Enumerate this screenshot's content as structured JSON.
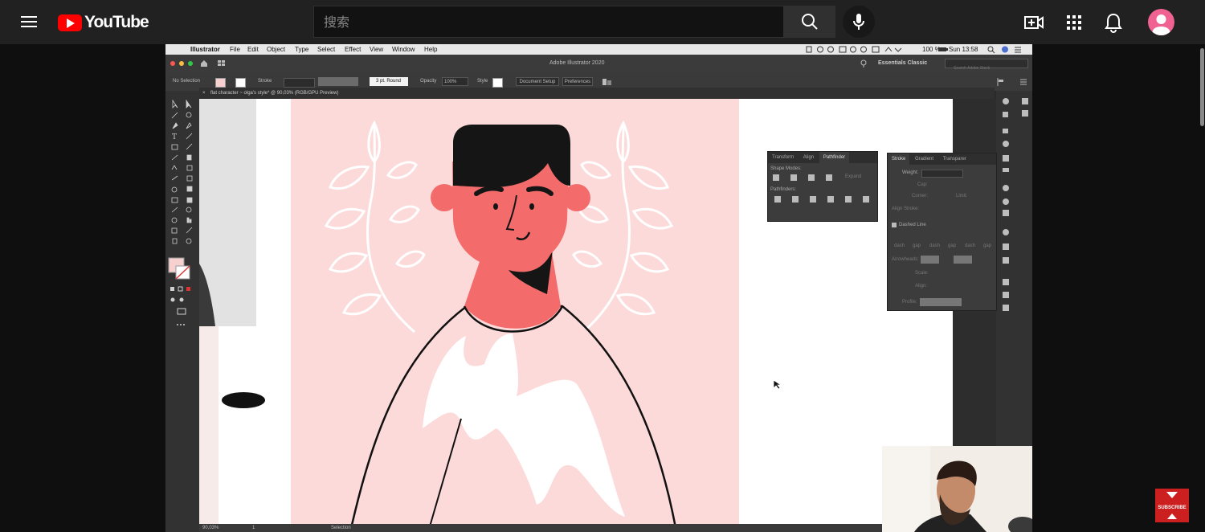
{
  "youtube": {
    "logo_text": "YouTube",
    "search_placeholder": "搜索",
    "icons": [
      "menu-icon",
      "search-icon",
      "mic-icon",
      "create-video-icon",
      "apps-grid-icon",
      "notifications-bell-icon",
      "account-avatar-icon"
    ],
    "colors": {
      "header_bg": "#212121",
      "page_bg": "#0f0f0f",
      "brand_red": "#ff0000",
      "avatar_pink": "#f06292"
    }
  },
  "mac_menubar": {
    "app": "Illustrator",
    "menus": [
      "File",
      "Edit",
      "Object",
      "Type",
      "Select",
      "Effect",
      "View",
      "Window",
      "Help"
    ],
    "battery": "100 %",
    "clock": "Sun 13:58"
  },
  "illustrator": {
    "window_title": "Adobe Illustrator 2020",
    "workspace": "Essentials Classic",
    "stock_search_placeholder": "Search Adobe Stock",
    "control_bar": {
      "selection": "No Selection",
      "stroke_label": "Stroke",
      "brush": "3 pt. Round",
      "opacity_label": "Opacity",
      "opacity_value": "100%",
      "style_label": "Style",
      "document_setup": "Document Setup",
      "preferences": "Preferences"
    },
    "doc_tab": "flat character ~ olga's style* @ 90,03% (RGB/GPU Preview)",
    "pathfinder_panel": {
      "tabs": [
        "Transform",
        "Align",
        "Pathfinder"
      ],
      "shape_modes_label": "Shape Modes:",
      "expand_label": "Expand",
      "pathfinders_label": "Pathfinders:"
    },
    "stroke_panel": {
      "tabs": [
        "Stroke",
        "Gradient",
        "Transparer"
      ],
      "weight_label": "Weight:",
      "cap_label": "Cap:",
      "corner_label": "Corner:",
      "limit_label": "Limit:",
      "align_stroke_label": "Align Stroke:",
      "dashed_line_label": "Dashed Line",
      "dash_gap_labels": [
        "dash",
        "gap",
        "dash",
        "gap",
        "dash",
        "gap"
      ],
      "arrowheads_label": "Arrowheads:",
      "scale_label": "Scale:",
      "align_label": "Align:",
      "profile_label": "Profile:"
    },
    "status_bar": {
      "zoom": "90,03%",
      "artboard": "1",
      "tool": "Selection"
    },
    "colors": {
      "artboard_pink": "#fddada",
      "skin": "#f36b6b",
      "hair": "#151515",
      "outline": "#111111"
    }
  },
  "overlay": {
    "subscribe_label": "SUBSCRIBE"
  }
}
